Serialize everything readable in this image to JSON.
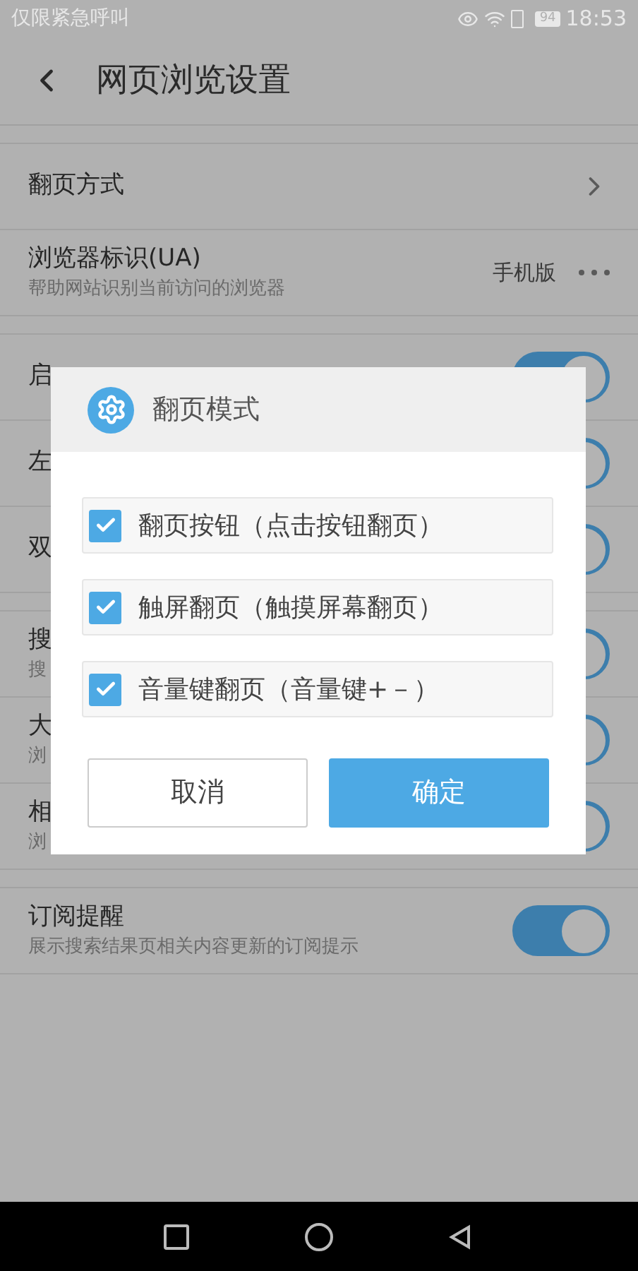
{
  "status_bar": {
    "carrier": "仅限紧急呼叫",
    "battery": "94",
    "time": "18:53"
  },
  "header": {
    "title": "网页浏览设置"
  },
  "groups": [
    [
      {
        "kind": "link",
        "title": "翻页方式"
      },
      {
        "kind": "value",
        "title": "浏览器标识(UA)",
        "subtitle": "帮助网站识别当前访问的浏览器",
        "value": "手机版"
      }
    ],
    [
      {
        "kind": "toggle",
        "title": "启",
        "on": true
      },
      {
        "kind": "toggle",
        "title": "左",
        "on": true
      },
      {
        "kind": "toggle",
        "title": "双",
        "on": true
      }
    ],
    [
      {
        "kind": "toggle",
        "title": "搜",
        "subtitle": "搜",
        "on": true
      },
      {
        "kind": "toggle",
        "title": "大",
        "subtitle": "浏",
        "on": true
      },
      {
        "kind": "toggle",
        "title": "相",
        "subtitle": "浏",
        "on": true
      }
    ],
    [
      {
        "kind": "toggle",
        "title": "订阅提醒",
        "subtitle": "展示搜索结果页相关内容更新的订阅提示",
        "on": true
      }
    ]
  ],
  "dialog": {
    "title": "翻页模式",
    "options": [
      {
        "label": "翻页按钮（点击按钮翻页）",
        "checked": true
      },
      {
        "label": "触屏翻页（触摸屏幕翻页）",
        "checked": true
      },
      {
        "label": "音量键翻页（音量键+－）",
        "checked": true
      }
    ],
    "buttons": [
      {
        "label": "取消",
        "primary": false
      },
      {
        "label": "确定",
        "primary": true
      }
    ]
  }
}
